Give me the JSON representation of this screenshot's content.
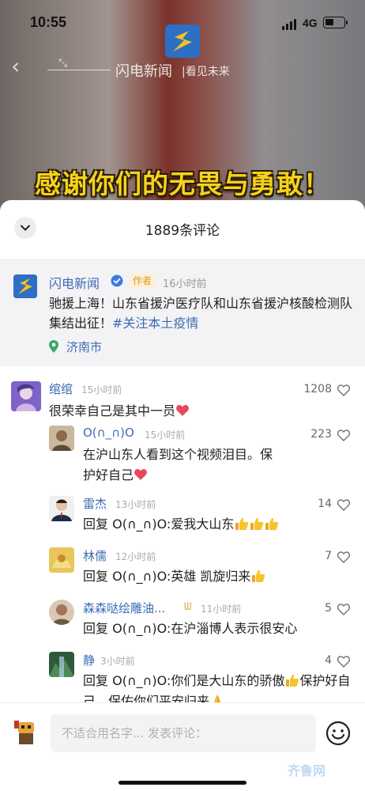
{
  "status_bar": {
    "time": "10:55",
    "network": "4G"
  },
  "video": {
    "brand_name": "闪电新闻",
    "brand_slogan": "|看见未来",
    "caption": "感谢你们的无畏与勇敢！"
  },
  "sheet": {
    "title": "1889条评论"
  },
  "post": {
    "author": "闪电新闻",
    "author_tag": "作者",
    "time": "16小时前",
    "content": "驰援上海！山东省援沪医疗队和山东省援沪核酸检测队集结出征！",
    "hashtag": "#关注本土疫情",
    "location": "济南市"
  },
  "comments": [
    {
      "name": "绾绾",
      "time": "15小时前",
      "likes": "1208",
      "text": "很荣幸自己是其中一员"
    },
    {
      "name": "O(∩_∩)O",
      "time": "15小时前",
      "likes": "223",
      "text": "在沪山东人看到这个视频泪目。保护好自己"
    },
    {
      "name": "雷杰",
      "time": "13小时前",
      "likes": "14",
      "reply_prefix": "回复",
      "reply_to": "O(∩_∩)O",
      "text": ":爱我大山东"
    },
    {
      "name": "林儒",
      "time": "12小时前",
      "likes": "7",
      "reply_prefix": "回复",
      "reply_to": "O(∩_∩)O",
      "text": ":英雄  凯旋归来"
    },
    {
      "name": "森森哒绘雕油...",
      "time": "11小时前",
      "likes": "5",
      "reply_prefix": "回复",
      "reply_to": "O(∩_∩)O",
      "text": ":在沪淄博人表示很安心"
    },
    {
      "name": "静",
      "time": "3小时前",
      "likes": "4",
      "reply_prefix": "回复",
      "reply_to": "O(∩_∩)O",
      "text": ":你们是大山东的骄傲",
      "text_2": "保护好自己，保佑你们平安归来"
    }
  ],
  "input": {
    "placeholder": "不适合用名字... 发表评论："
  },
  "watermark": "齐鲁网",
  "colors": {
    "link": "#3c6bb3",
    "caption": "#f6d21a",
    "heart": "#e8475f",
    "brand": "#2d6fc4"
  }
}
